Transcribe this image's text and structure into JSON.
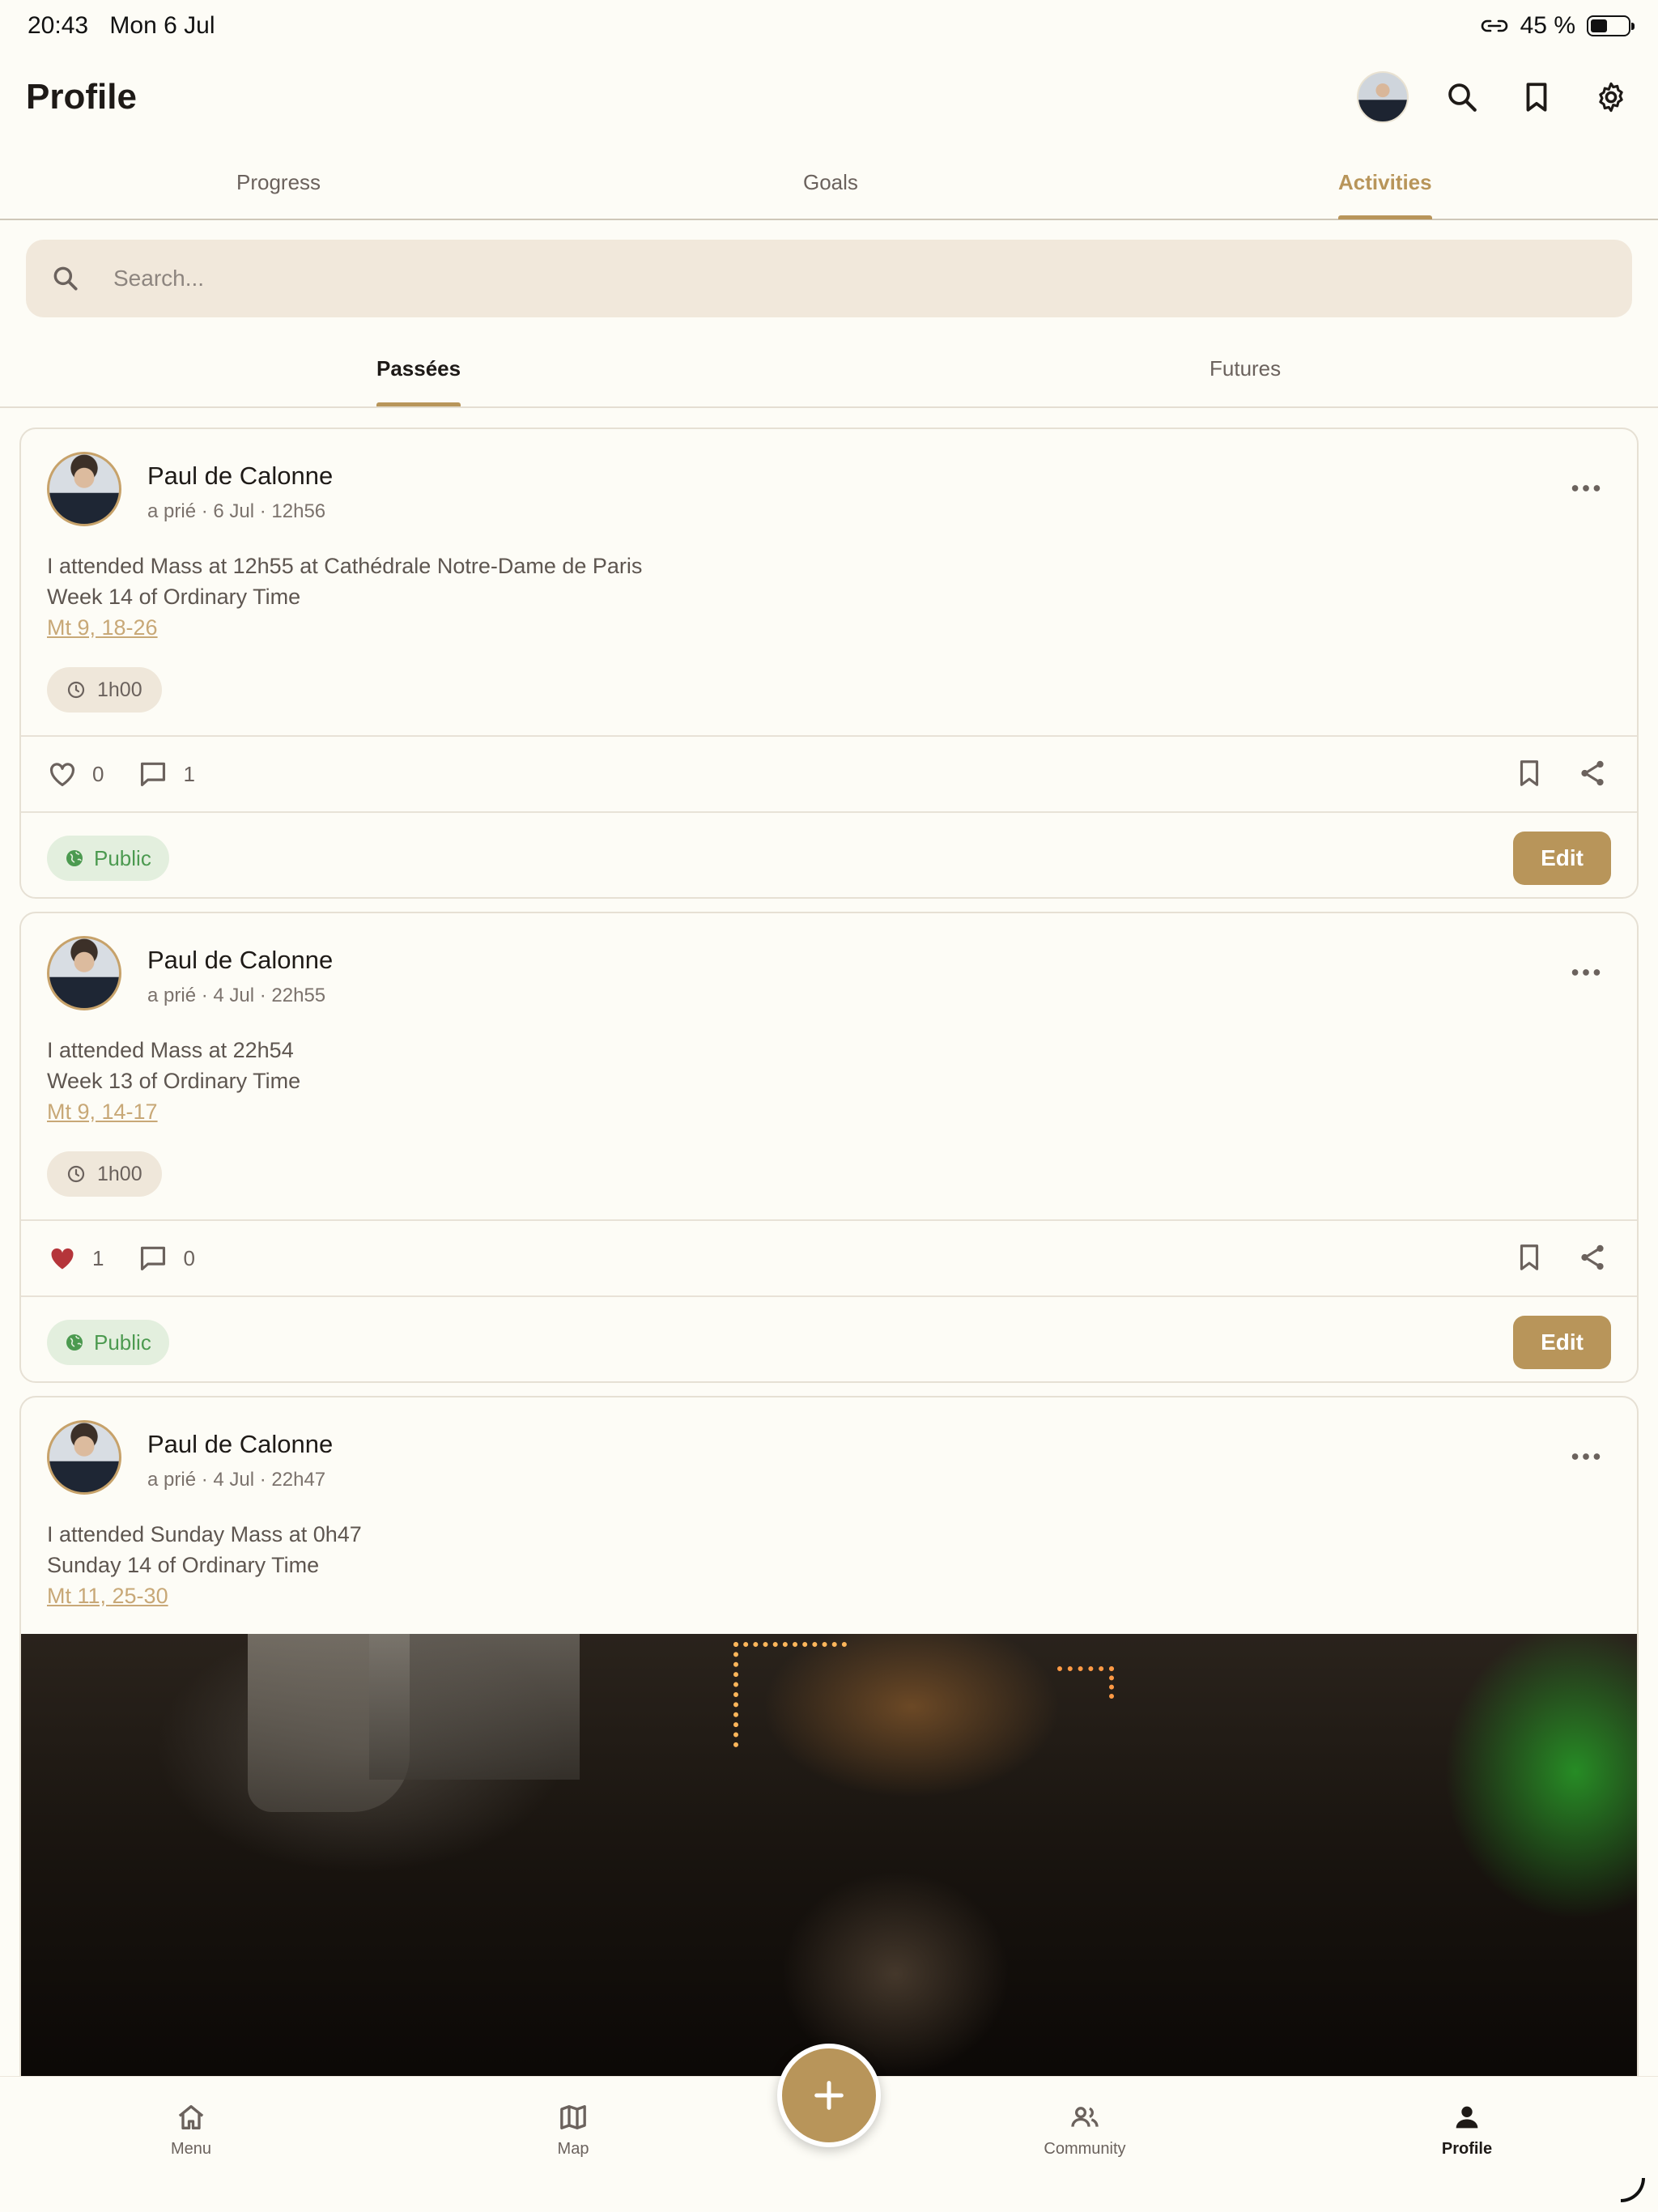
{
  "status_bar": {
    "time": "20:43",
    "date": "Mon 6 Jul",
    "battery": "45 %",
    "battery_level": 0.45
  },
  "header": {
    "title": "Profile"
  },
  "top_tabs": [
    {
      "label": "Progress",
      "active": false
    },
    {
      "label": "Goals",
      "active": false
    },
    {
      "label": "Activities",
      "active": true
    }
  ],
  "search": {
    "placeholder": "Search...",
    "value": ""
  },
  "sub_tabs": [
    {
      "label": "Passées",
      "active": true
    },
    {
      "label": "Futures",
      "active": false
    }
  ],
  "activities": [
    {
      "author": "Paul de Calonne",
      "action": "a prié",
      "when": "· 6 Jul · 12h56",
      "lines": [
        "I attended Mass at 12h55 at Cathédrale Notre-Dame de Paris",
        "Week 14 of Ordinary Time"
      ],
      "reference": "Mt 9, 18-26",
      "duration": "1h00",
      "likes": "0",
      "liked": false,
      "comments": "1",
      "visibility": "Public",
      "edit_label": "Edit"
    },
    {
      "author": "Paul de Calonne",
      "action": "a prié",
      "when": "· 4 Jul · 22h55",
      "lines": [
        "I attended Mass at 22h54",
        "Week 13 of Ordinary Time"
      ],
      "reference": "Mt 9, 14-17",
      "duration": "1h00",
      "likes": "1",
      "liked": true,
      "comments": "0",
      "visibility": "Public",
      "edit_label": "Edit"
    },
    {
      "author": "Paul de Calonne",
      "action": "a prié",
      "when": "· 4 Jul · 22h47",
      "lines": [
        "I attended Sunday Mass at 0h47",
        "Sunday 14 of Ordinary Time"
      ],
      "reference": "Mt 11, 25-30"
    }
  ],
  "bottom_nav": [
    {
      "label": "Menu",
      "icon": "home-icon",
      "active": false
    },
    {
      "label": "Map",
      "icon": "map-icon",
      "active": false
    },
    {
      "label": "Community",
      "icon": "people-icon",
      "active": false
    },
    {
      "label": "Profile",
      "icon": "person-icon",
      "active": true
    }
  ],
  "colors": {
    "accent": "#b8955a",
    "background": "#fdfcf6",
    "search_bg": "#f1e8db",
    "public_green": "#4c9a50",
    "like_red": "#b5353a"
  }
}
